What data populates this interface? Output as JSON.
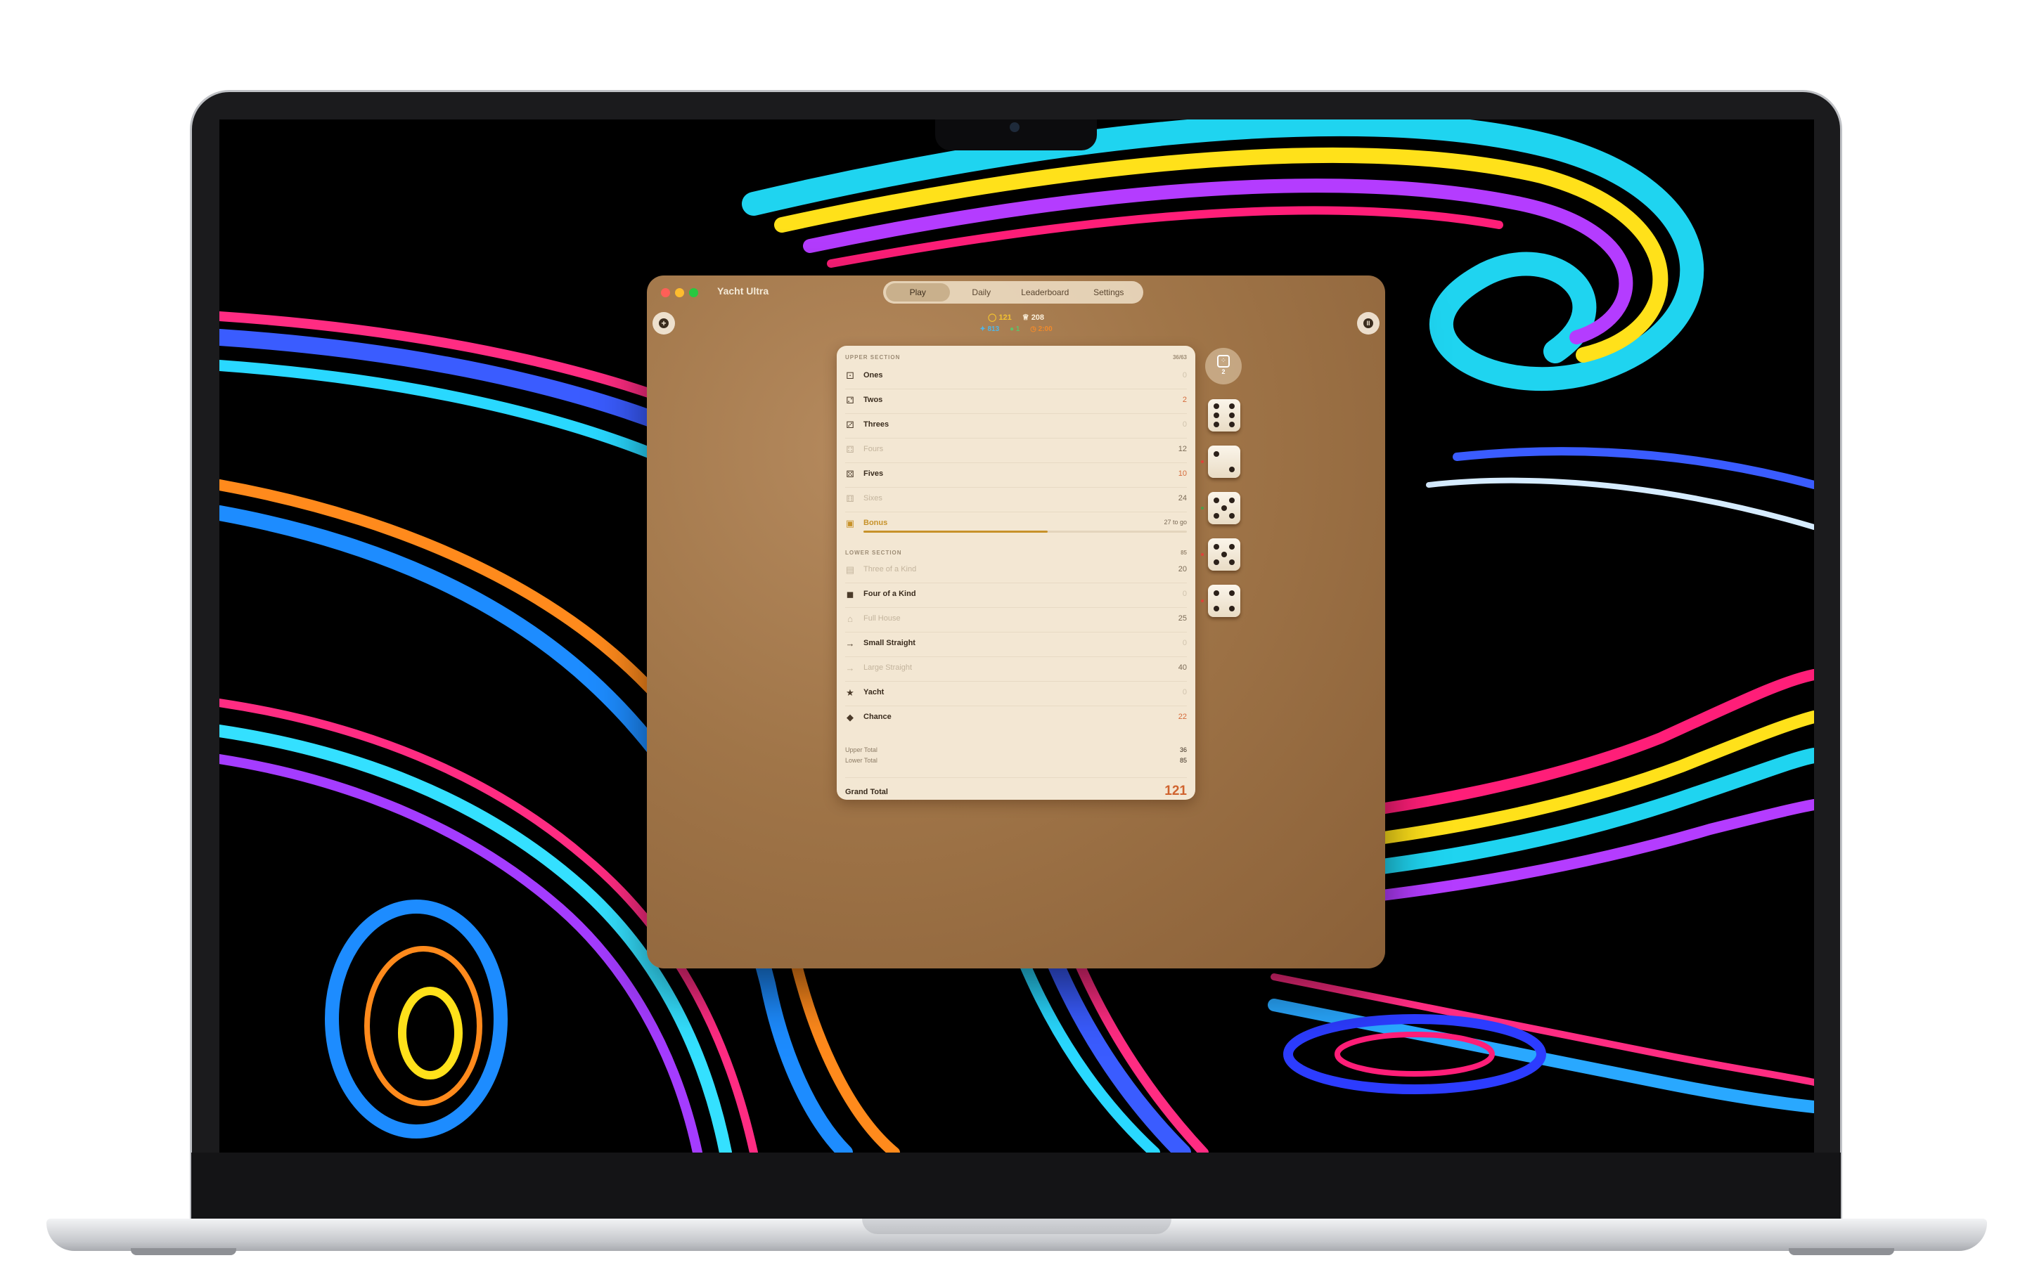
{
  "window": {
    "title": "Yacht Ultra"
  },
  "tabs": [
    {
      "label": "Play",
      "active": true
    },
    {
      "label": "Daily",
      "active": false
    },
    {
      "label": "Leaderboard",
      "active": false
    },
    {
      "label": "Settings",
      "active": false
    }
  ],
  "stats": {
    "score": "121",
    "best": "208",
    "stat_blue": "813",
    "stat_green": "1",
    "stat_orange": "2:00"
  },
  "roll_button": {
    "icon": "dice-icon",
    "rolls_left": "2"
  },
  "upper_section": {
    "title": "UPPER SECTION",
    "progress": "36/63",
    "rows": [
      {
        "label": "Ones",
        "value": "0",
        "icon": "die-face-1-icon",
        "used": false
      },
      {
        "label": "Twos",
        "value": "2",
        "icon": "die-face-2-icon",
        "used": false
      },
      {
        "label": "Threes",
        "value": "0",
        "icon": "die-face-3-icon",
        "used": false
      },
      {
        "label": "Fours",
        "value": "12",
        "icon": "die-face-4-icon",
        "used": true
      },
      {
        "label": "Fives",
        "value": "10",
        "icon": "die-face-5-icon",
        "used": false
      },
      {
        "label": "Sixes",
        "value": "24",
        "icon": "die-face-6-icon",
        "used": true
      }
    ],
    "bonus": {
      "label": "Bonus",
      "status": "27 to go",
      "progress_fraction": 0.57
    }
  },
  "lower_section": {
    "title": "LOWER SECTION",
    "total": "85",
    "rows": [
      {
        "label": "Three of a Kind",
        "value": "20",
        "icon": "three-kind-icon",
        "used": true
      },
      {
        "label": "Four of a Kind",
        "value": "0",
        "icon": "four-kind-icon",
        "used": false
      },
      {
        "label": "Full House",
        "value": "25",
        "icon": "house-icon",
        "used": true
      },
      {
        "label": "Small Straight",
        "value": "0",
        "icon": "arrow-right-icon",
        "used": false
      },
      {
        "label": "Large Straight",
        "value": "40",
        "icon": "arrow-right-icon",
        "used": true
      },
      {
        "label": "Yacht",
        "value": "0",
        "icon": "star-icon",
        "used": false
      },
      {
        "label": "Chance",
        "value": "22",
        "icon": "question-icon",
        "used": false
      }
    ]
  },
  "totals": {
    "upper_label": "Upper Total",
    "upper_value": "36",
    "lower_label": "Lower Total",
    "lower_value": "85",
    "grand_label": "Grand Total",
    "grand_value": "121"
  },
  "dice": [
    6,
    2,
    5,
    5,
    4
  ],
  "colors": {
    "accent": "#d0632e",
    "bonus": "#c7922a",
    "window_bg": "#a07548",
    "card_bg": "#f3e7d3"
  }
}
